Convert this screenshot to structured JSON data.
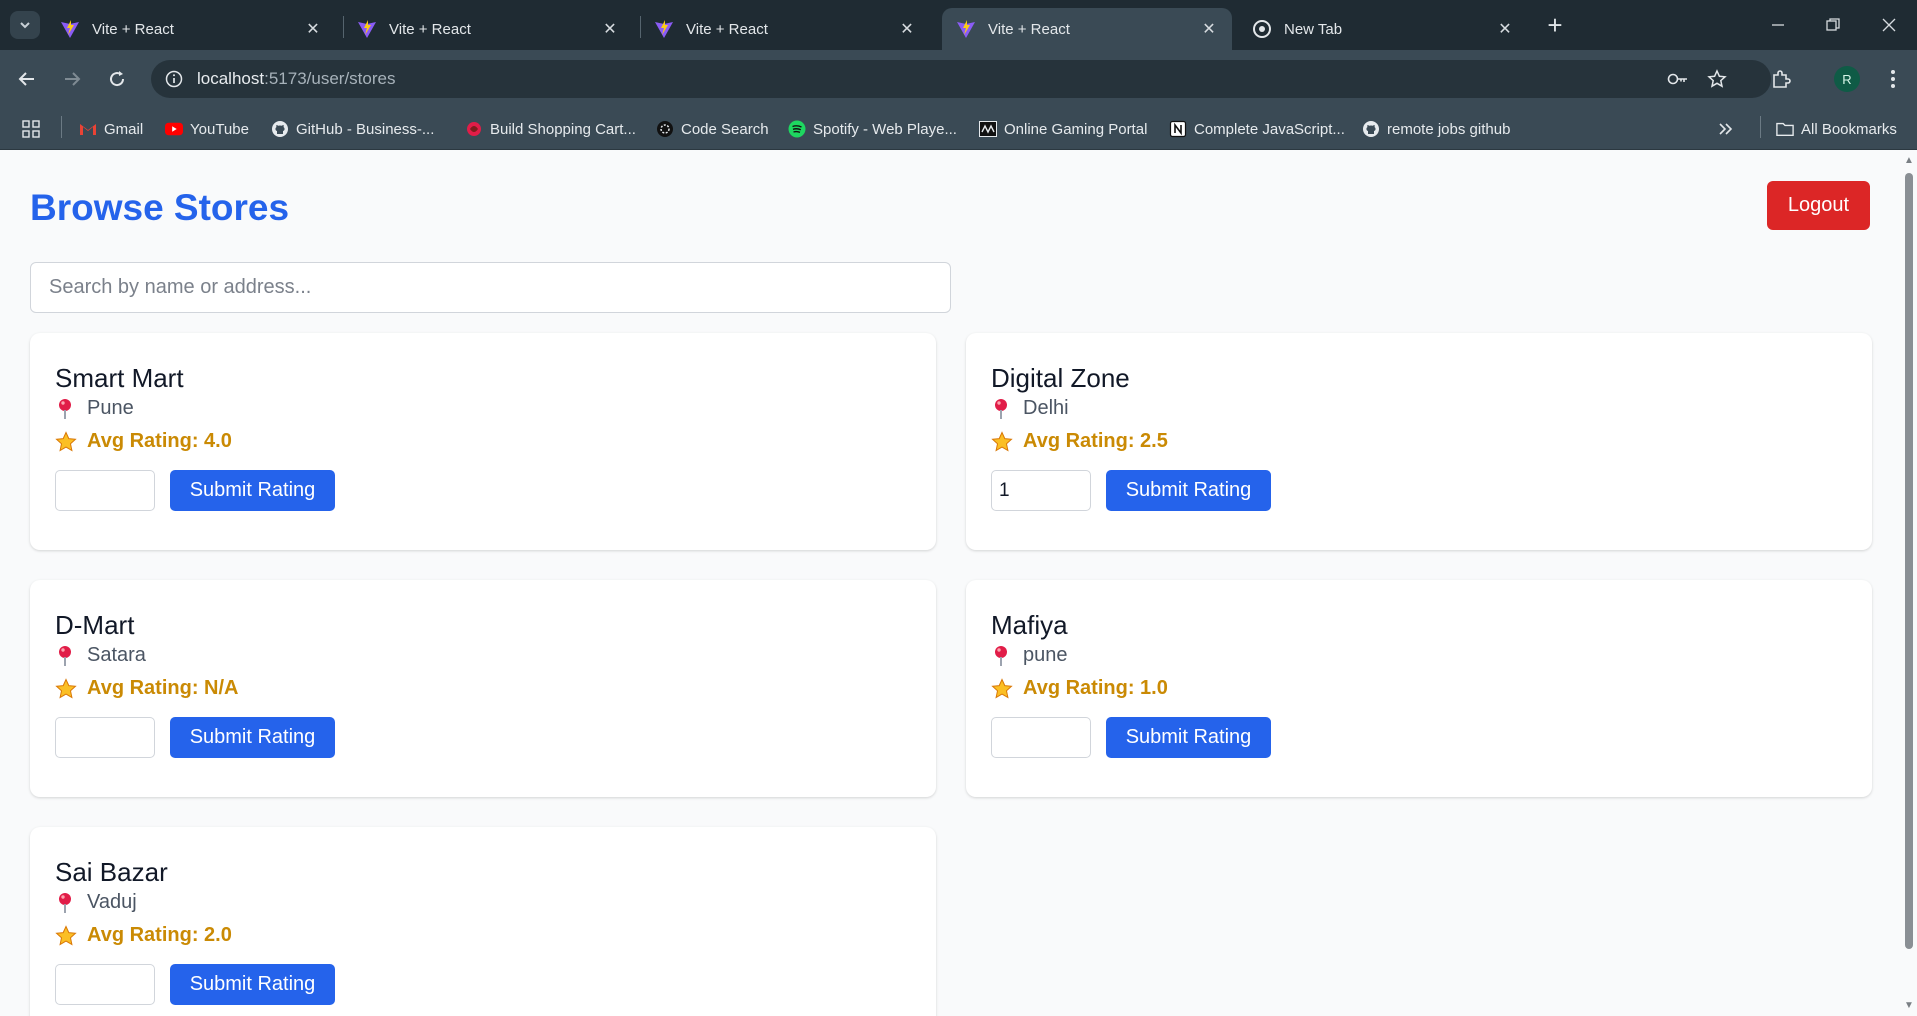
{
  "browser": {
    "tabs": [
      {
        "title": "Vite + React",
        "icon": "vite-icon",
        "active": false
      },
      {
        "title": "Vite + React",
        "icon": "vite-icon",
        "active": false
      },
      {
        "title": "Vite + React",
        "icon": "vite-icon",
        "active": false
      },
      {
        "title": "Vite + React",
        "icon": "vite-icon",
        "active": true
      },
      {
        "title": "New Tab",
        "icon": "chrome-icon",
        "active": false
      }
    ],
    "url_host": "localhost",
    "url_path": ":5173/user/stores",
    "profile_initial": "R",
    "bookmarks": [
      {
        "label": "Gmail",
        "icon": "gmail-icon"
      },
      {
        "label": "YouTube",
        "icon": "youtube-icon"
      },
      {
        "label": "GitHub - Business-...",
        "icon": "github-icon"
      },
      {
        "label": "Build Shopping Cart...",
        "icon": "shopping-icon"
      },
      {
        "label": "Code Search",
        "icon": "code-search-icon"
      },
      {
        "label": "Spotify - Web Playe...",
        "icon": "spotify-icon"
      },
      {
        "label": "Online Gaming Portal",
        "icon": "gaming-icon"
      },
      {
        "label": "Complete JavaScript...",
        "icon": "notion-icon"
      },
      {
        "label": "remote jobs github",
        "icon": "github-icon"
      }
    ],
    "all_bookmarks_label": "All Bookmarks"
  },
  "page": {
    "title": "Browse Stores",
    "logout_label": "Logout",
    "search_placeholder": "Search by name or address...",
    "submit_label": "Submit Rating",
    "rating_prefix": "Avg Rating: ",
    "stores": [
      {
        "name": "Smart Mart",
        "address": "Pune",
        "avg_rating": "4.0",
        "input_value": ""
      },
      {
        "name": "Digital Zone",
        "address": "Delhi",
        "avg_rating": "2.5",
        "input_value": "1"
      },
      {
        "name": "D-Mart",
        "address": "Satara",
        "avg_rating": "N/A",
        "input_value": ""
      },
      {
        "name": "Mafiya",
        "address": "pune",
        "avg_rating": "1.0",
        "input_value": ""
      },
      {
        "name": "Sai Bazar",
        "address": "Vaduj",
        "avg_rating": "2.0",
        "input_value": ""
      }
    ]
  },
  "colors": {
    "title_blue": "#2563eb",
    "logout_red": "#dc2626",
    "rating_gold": "#ca8a04"
  }
}
